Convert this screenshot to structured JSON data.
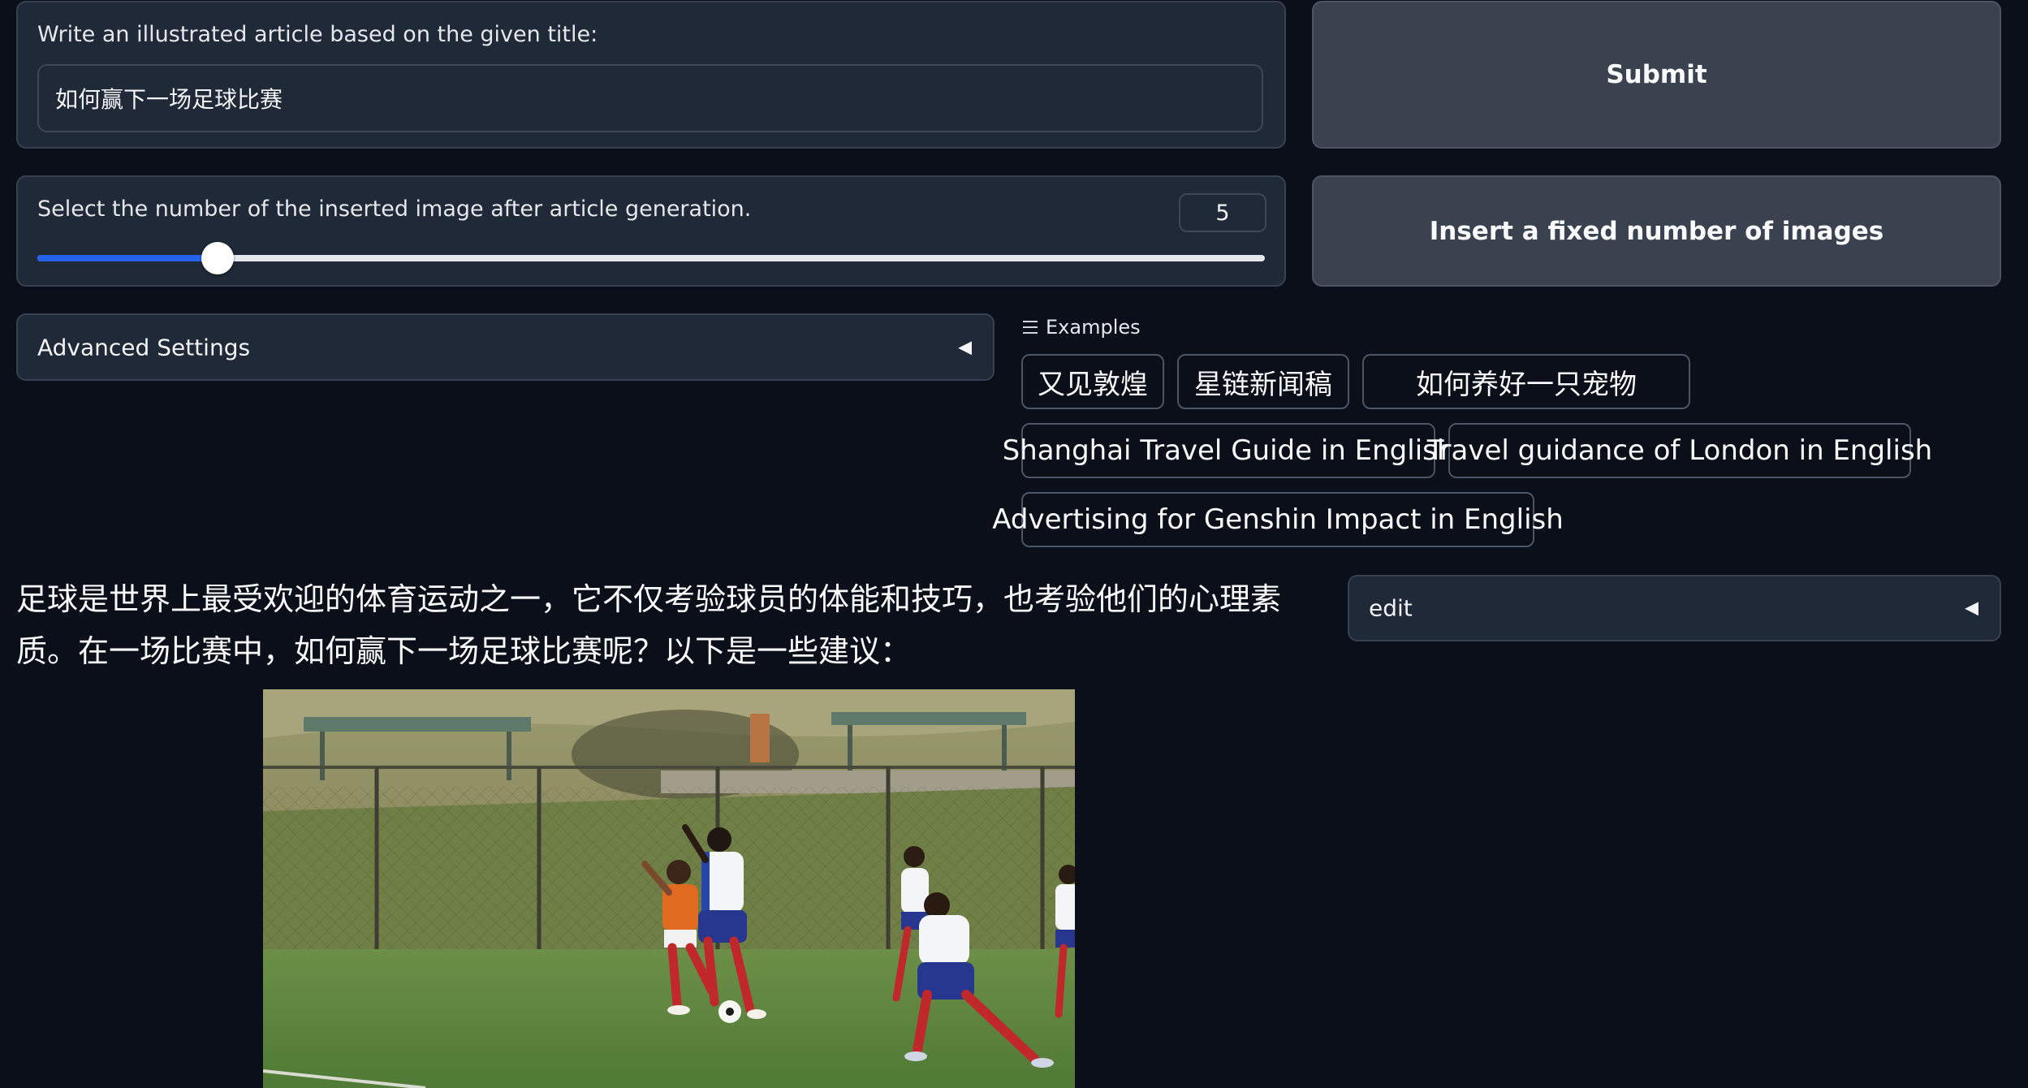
{
  "title_input": {
    "label": "Write an illustrated article based on the given title:",
    "value": "如何赢下一场足球比赛"
  },
  "submit_button": {
    "label": "Submit"
  },
  "image_count": {
    "label": "Select the number of the inserted image after article generation.",
    "value": "5",
    "fraction": 0.147
  },
  "insert_button": {
    "label": "Insert a fixed number of images"
  },
  "advanced_settings": {
    "label": "Advanced Settings",
    "arrow": "◀"
  },
  "examples": {
    "heading": "Examples",
    "items": [
      "又见敦煌",
      "星链新闻稿",
      "如何养好一只宠物",
      "Shanghai Travel Guide in English",
      "Travel guidance of London in English",
      "Advertising for Genshin Impact in English"
    ]
  },
  "article": {
    "paragraph": "足球是世界上最受欢迎的体育运动之一，它不仅考验球员的体能和技巧，也考验他们的心理素质。在一场比赛中，如何赢下一场足球比赛呢？以下是一些建议："
  },
  "edit_panel": {
    "label": "edit",
    "arrow": "◀"
  },
  "colors": {
    "background": "#0b0f19",
    "panel": "#1f2937",
    "button": "#3a4250",
    "slider_accent": "#2563eb"
  }
}
